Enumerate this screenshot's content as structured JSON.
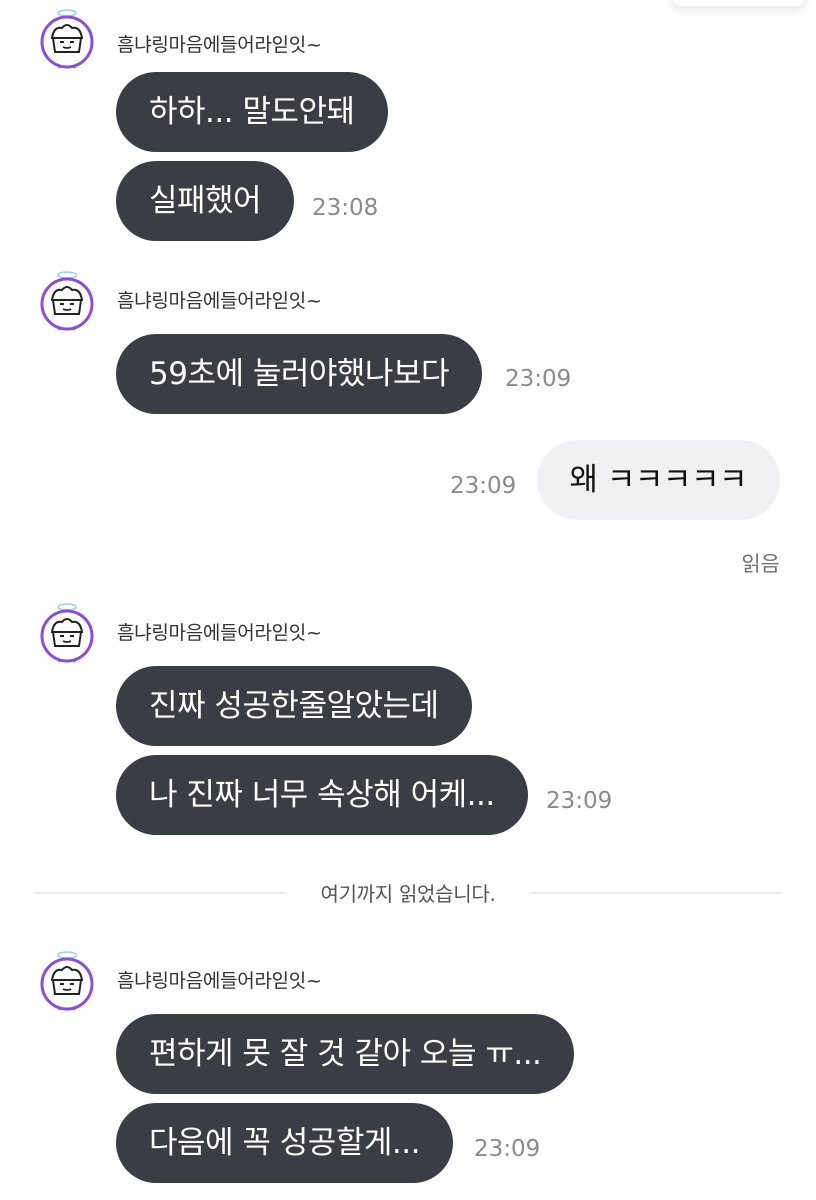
{
  "colors": {
    "incoming_bubble": "#3b3d44",
    "outgoing_bubble": "#f1f1f4",
    "timestamp": "#8a8a8f",
    "avatar_accent": "#8a4fd8"
  },
  "sender_name": "흠냐링마음에들어라읻잇~",
  "groups": [
    {
      "sender": "흠냐링마음에들어라읻잇~",
      "messages": [
        "하하... 말도안돼",
        "실패했어"
      ],
      "time": "23:08"
    },
    {
      "sender": "흠냐링마음에들어라읻잇~",
      "messages": [
        "59초에 눌러야했나보다"
      ],
      "time": "23:09"
    },
    {
      "sender": "흠냐링마음에들어라읻잇~",
      "messages": [
        "진짜 성공한줄알았는데",
        "나 진짜 너무 속상해 어케..."
      ],
      "time": "23:09"
    },
    {
      "sender": "흠냐링마음에들어라읻잇~",
      "messages": [
        "편하게 못 잘 것 같아 오늘 ㅠ...",
        "다음에 꼭 성공할게..."
      ],
      "time": "23:09"
    }
  ],
  "outgoing": {
    "message": "왜 ㅋㅋㅋㅋㅋ",
    "time": "23:09",
    "read_status": "읽음"
  },
  "read_divider": "여기까지 읽었습니다."
}
